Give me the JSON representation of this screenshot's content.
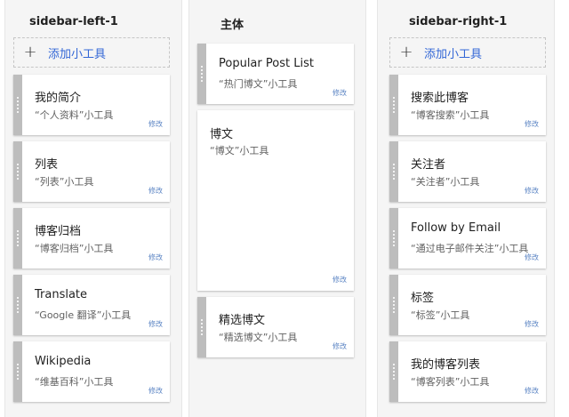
{
  "columns": {
    "left": {
      "title": "sidebar-left-1",
      "add_label": "添加小工具",
      "widgets": [
        {
          "title": "我的简介",
          "subtitle": "“个人资料”小工具",
          "edit": "修改"
        },
        {
          "title": "列表",
          "subtitle": "“列表”小工具",
          "edit": "修改"
        },
        {
          "title": "博客归档",
          "subtitle": "“博客归档”小工具",
          "edit": "修改"
        },
        {
          "title": "Translate",
          "subtitle": "“Google 翻译”小工具",
          "edit": "修改"
        },
        {
          "title": "Wikipedia",
          "subtitle": "“维基百科”小工具",
          "edit": "修改"
        }
      ]
    },
    "main": {
      "title": "主体",
      "widgets": [
        {
          "title": "Popular Post List",
          "subtitle": "“热门博文”小工具",
          "edit": "修改"
        },
        {
          "title": "博文",
          "subtitle": "“博文”小工具",
          "edit": "修改"
        },
        {
          "title": "精选博文",
          "subtitle": "“精选博文”小工具",
          "edit": "修改"
        }
      ]
    },
    "right": {
      "title": "sidebar-right-1",
      "add_label": "添加小工具",
      "widgets": [
        {
          "title": "搜索此博客",
          "subtitle": "“博客搜索”小工具",
          "edit": "修改"
        },
        {
          "title": "关注者",
          "subtitle": "“关注者”小工具",
          "edit": "修改"
        },
        {
          "title": "Follow by Email",
          "subtitle": "“通过电子邮件关注”小工具",
          "edit": "修改"
        },
        {
          "title": "标签",
          "subtitle": "“标签”小工具",
          "edit": "修改"
        },
        {
          "title": "我的博客列表",
          "subtitle": "“博客列表”小工具",
          "edit": "修改"
        }
      ]
    }
  },
  "icons": {
    "add": "plus-icon",
    "drag": "drag-handle-icon"
  },
  "colors": {
    "link": "#3367d6",
    "edit": "#5c85c4",
    "handle": "#bdbdbd",
    "column_bg": "#f5f5f5"
  }
}
